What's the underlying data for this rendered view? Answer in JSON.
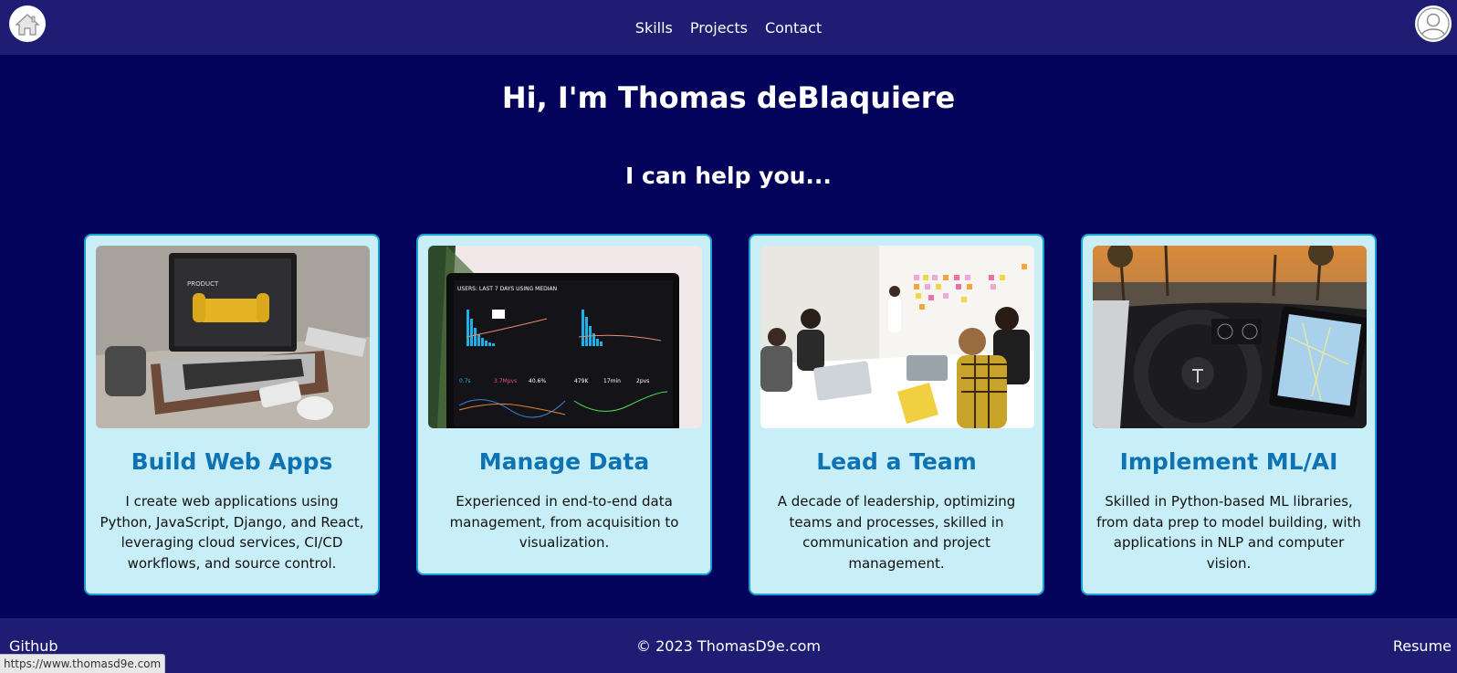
{
  "nav": {
    "home_icon": "house-icon",
    "profile_icon": "user-avatar-icon",
    "links": [
      "Skills",
      "Projects",
      "Contact"
    ]
  },
  "hero": {
    "title": "Hi, I'm Thomas deBlaquiere",
    "subtitle": "I can help you..."
  },
  "cards": [
    {
      "title": "Build Web Apps",
      "text": "I create web applications using Python, JavaScript, Django, and React, leveraging cloud services, CI/CD workflows, and source control.",
      "image": "laptop-with-product-page-photo"
    },
    {
      "title": "Manage Data",
      "text": "Experienced in end-to-end data management, from acquisition to visualization.",
      "image": "analytics-dashboard-monitor-photo"
    },
    {
      "title": "Lead a Team",
      "text": "A decade of leadership, optimizing teams and processes, skilled in communication and project management.",
      "image": "team-meeting-sticky-notes-photo"
    },
    {
      "title": "Implement ML/AI",
      "text": "Skilled in Python-based ML libraries, from data prep to model building, with applications in NLP and computer vision.",
      "image": "self-driving-car-interior-photo"
    }
  ],
  "footer": {
    "github": "Github",
    "copyright": "© 2023 ThomasD9e.com",
    "resume": "Resume"
  },
  "status_bar": {
    "url": "https://www.thomasd9e.com"
  },
  "colors": {
    "page_bg": "#03035c",
    "nav_bg": "#1e1d73",
    "card_bg": "#c8eff7",
    "card_border": "#1a9ed6",
    "card_title": "#0e72b3"
  }
}
